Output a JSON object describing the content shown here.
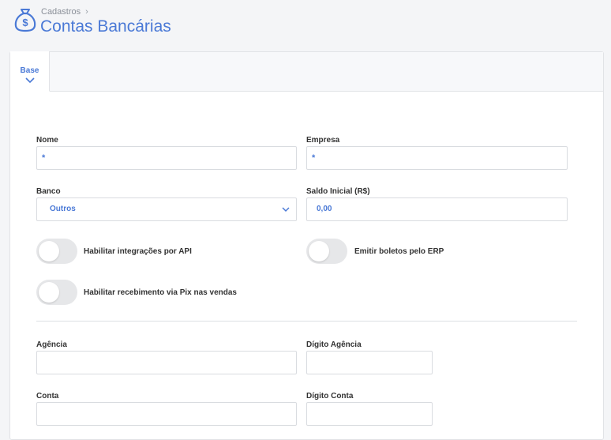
{
  "header": {
    "breadcrumb": "Cadastros",
    "title": "Contas Bancárias",
    "icon": "money-bag-icon"
  },
  "tabs": [
    {
      "label": "Base",
      "active": true
    }
  ],
  "form": {
    "nome": {
      "label": "Nome",
      "value": "*"
    },
    "empresa": {
      "label": "Empresa",
      "value": "*"
    },
    "banco": {
      "label": "Banco",
      "value": "Outros"
    },
    "saldo_inicial": {
      "label": "Saldo Inicial (R$)",
      "value": "0,00"
    },
    "toggles": {
      "api": {
        "label": "Habilitar integrações por API",
        "on": false
      },
      "boletos": {
        "label": "Emitir boletos pelo ERP",
        "on": false
      },
      "pix": {
        "label": "Habilitar recebimento via Pix nas vendas",
        "on": false
      }
    },
    "agencia": {
      "label": "Agência",
      "value": ""
    },
    "digito_agencia": {
      "label": "Dígito Agência",
      "value": ""
    },
    "conta": {
      "label": "Conta",
      "value": ""
    },
    "digito_conta": {
      "label": "Dígito Conta",
      "value": ""
    }
  },
  "colors": {
    "accent": "#4a79d6",
    "toggle_off": "#e6e7e9"
  }
}
